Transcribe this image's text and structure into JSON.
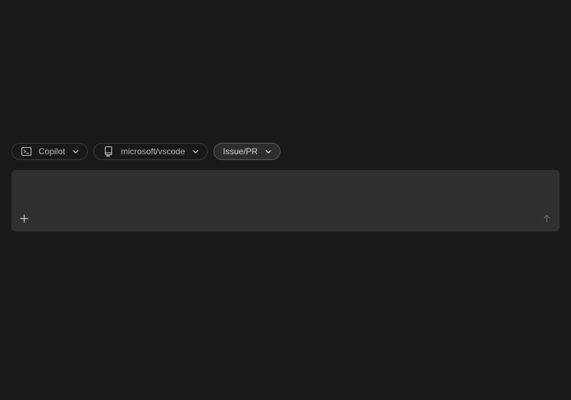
{
  "toolbar": {
    "agent": {
      "label": "Copilot",
      "icon": "terminal-icon"
    },
    "repo": {
      "label": "microsoft/vscode",
      "icon": "repo-icon"
    },
    "context": {
      "label": "Issue/PR"
    }
  },
  "composer": {
    "placeholder": "",
    "add_icon": "plus-icon",
    "send_icon": "arrow-up-icon"
  },
  "colors": {
    "background": "#191919",
    "composer_bg": "#303030",
    "pill_border": "#3c3c3c",
    "text": "#b8b8b8"
  }
}
